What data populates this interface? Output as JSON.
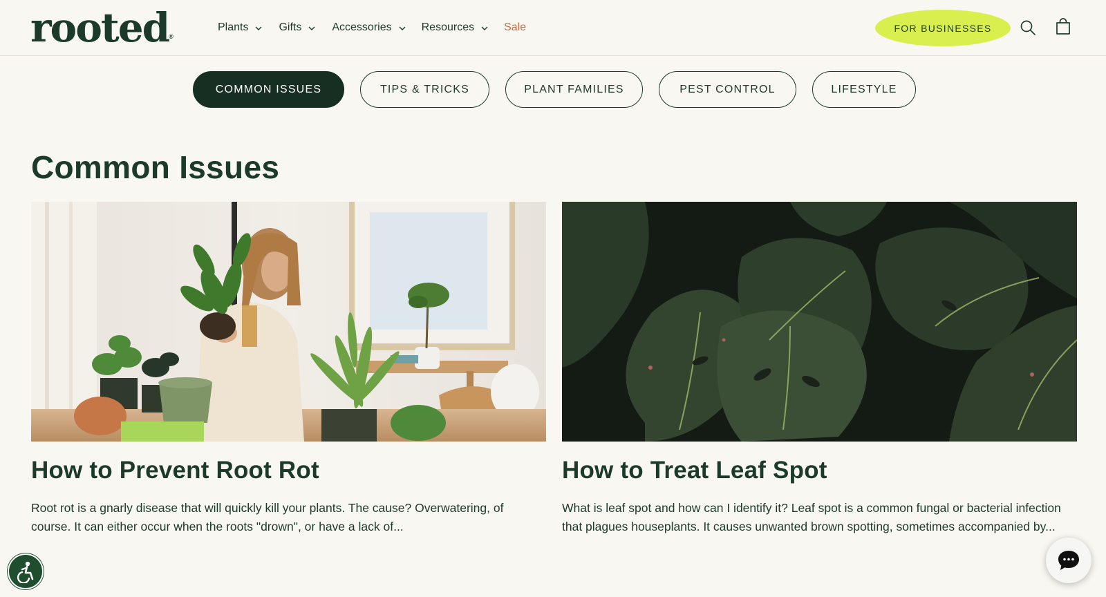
{
  "header": {
    "logo_text": "rooted",
    "logo_mark": "®",
    "nav": [
      {
        "label": "Plants",
        "has_dropdown": true
      },
      {
        "label": "Gifts",
        "has_dropdown": true
      },
      {
        "label": "Accessories",
        "has_dropdown": true
      },
      {
        "label": "Resources",
        "has_dropdown": true
      },
      {
        "label": "Sale",
        "has_dropdown": false
      }
    ],
    "business_button": "FOR BUSINESSES",
    "search_icon": "search-icon",
    "cart_icon": "cart-icon"
  },
  "tabs": [
    {
      "label": "COMMON ISSUES",
      "active": true
    },
    {
      "label": "TIPS & TRICKS",
      "active": false
    },
    {
      "label": "PLANT FAMILIES",
      "active": false
    },
    {
      "label": "PEST CONTROL",
      "active": false
    },
    {
      "label": "LIFESTYLE",
      "active": false
    }
  ],
  "section": {
    "title": "Common Issues"
  },
  "articles": [
    {
      "title": "How to Prevent Root Rot",
      "excerpt": "Root rot is a gnarly disease that will quickly kill your plants. The cause? Overwatering, of course. It can either occur when the roots \"drown\", or have a lack of...",
      "image": "woman-potting-plants-photo"
    },
    {
      "title": "How to Treat Leaf Spot",
      "excerpt": "What is leaf spot and how can I identify it? Leaf spot is a common fungal or bacterial infection that plagues houseplants. It causes unwanted brown spotting, sometimes accompanied by...",
      "image": "monstera-leaves-photo"
    }
  ],
  "floating": {
    "accessibility_icon": "accessibility-icon",
    "chat_icon": "chat-icon"
  },
  "colors": {
    "background": "#f9f7f1",
    "brand_green": "#1c3a2a",
    "accent_lime": "#d8ef4e",
    "sale_orange": "#d36a3c"
  }
}
